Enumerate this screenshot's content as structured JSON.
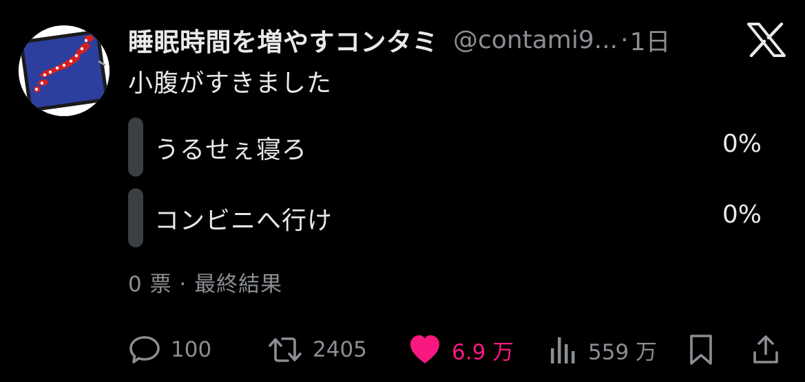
{
  "post": {
    "display_name": "睡眠時間を増やすコンタミ",
    "handle": "@contami9...",
    "separator": "·",
    "time": "1日",
    "text": "小腹がすきました"
  },
  "poll": {
    "options": [
      {
        "label": "うるせぇ寝ろ",
        "percent": "0%",
        "fraction": 0
      },
      {
        "label": "コンビニへ行け",
        "percent": "0%",
        "fraction": 0
      }
    ],
    "meta": "0 票 · 最終結果"
  },
  "actions": {
    "replies": "100",
    "reposts": "2405",
    "likes": "6.9 万",
    "views": "559 万"
  },
  "colors": {
    "background": "#000000",
    "text": "#e7e9ea",
    "muted": "#8b8f94",
    "like": "#f91880",
    "poll_bar": "#3b3e42",
    "avatar_blue": "#2c3f9e",
    "avatar_red": "#d62020"
  },
  "icons": {
    "brand": "x-logo-icon",
    "reply": "speech-bubble-icon",
    "repost": "repost-arrows-icon",
    "like": "heart-icon",
    "views": "bar-chart-icon",
    "bookmark": "bookmark-icon",
    "share": "share-icon"
  }
}
